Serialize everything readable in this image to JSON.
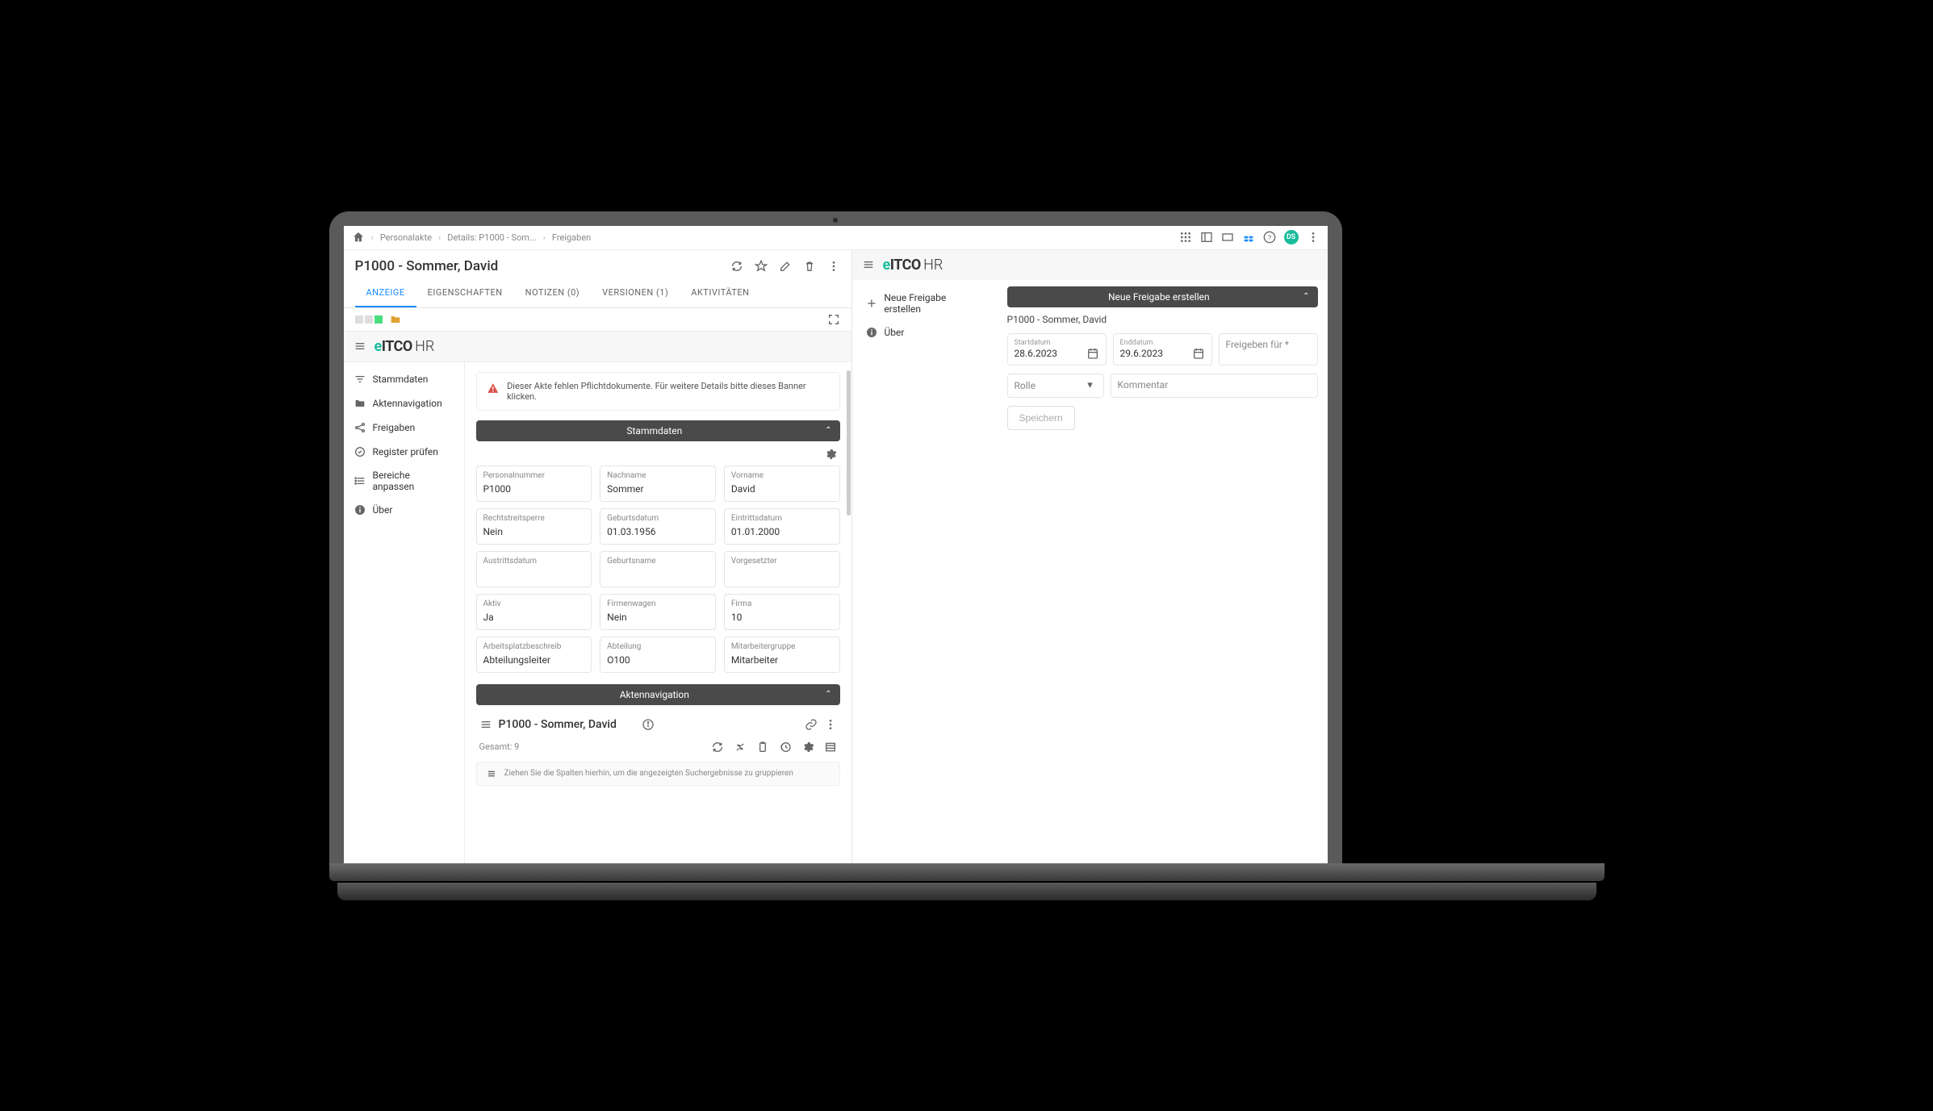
{
  "breadcrumbs": {
    "c1": "Personalakte",
    "c2": "Details: P1000 - Som...",
    "c3": "Freigaben"
  },
  "topRight": {
    "avatar": "DS"
  },
  "doc": {
    "title": "P1000 - Sommer, David"
  },
  "tabs": {
    "anzeige": "ANZEIGE",
    "eigenschaften": "EIGENSCHAFTEN",
    "notizen": "NOTIZEN (0)",
    "versionen": "VERSIONEN (1)",
    "aktivitaeten": "AKTIVITÄTEN"
  },
  "logo": {
    "e": "e",
    "itco": "ITCO",
    "hr": "HR"
  },
  "sideNav": {
    "stammdaten": "Stammdaten",
    "aktennav": "Aktennavigation",
    "freigaben": "Freigaben",
    "register": "Register prüfen",
    "bereiche": "Bereiche anpassen",
    "ueber": "Über"
  },
  "banner": {
    "text": "Dieser Akte fehlen Pflichtdokumente. Für weitere Details bitte dieses Banner klicken."
  },
  "sect": {
    "stammdaten": "Stammdaten",
    "aktennav": "Aktennavigation"
  },
  "fields": {
    "personalnummer": {
      "l": "Personalnummer",
      "v": "P1000"
    },
    "nachname": {
      "l": "Nachname",
      "v": "Sommer"
    },
    "vorname": {
      "l": "Vorname",
      "v": "David"
    },
    "rechtstreitsperre": {
      "l": "Rechtstreitsperre",
      "v": "Nein"
    },
    "geburtsdatum": {
      "l": "Geburtsdatum",
      "v": "01.03.1956"
    },
    "eintrittsdatum": {
      "l": "Eintrittsdatum",
      "v": "01.01.2000"
    },
    "austrittsdatum": {
      "l": "Austrittsdatum",
      "v": ""
    },
    "geburtsname": {
      "l": "Geburtsname",
      "v": ""
    },
    "vorgesetzter": {
      "l": "Vorgesetzter",
      "v": ""
    },
    "aktiv": {
      "l": "Aktiv",
      "v": "Ja"
    },
    "firmenwagen": {
      "l": "Firmenwagen",
      "v": "Nein"
    },
    "firma": {
      "l": "Firma",
      "v": "10"
    },
    "arbeitsplatz": {
      "l": "Arbeitsplatzbeschreib",
      "v": "Abteilungsleiter"
    },
    "abteilung": {
      "l": "Abteilung",
      "v": "O100"
    },
    "mitarbeitergruppe": {
      "l": "Mitarbeitergruppe",
      "v": "Mitarbeiter"
    }
  },
  "akten": {
    "title": "P1000 - Sommer, David",
    "count": "Gesamt: 9",
    "drag": "Ziehen Sie die Spalten hierhin, um die angezeigten Suchergebnisse zu gruppieren"
  },
  "rightNav": {
    "neue": "Neue Freigabe erstellen",
    "ueber": "Über"
  },
  "freigabe": {
    "title": "Neue Freigabe erstellen",
    "sub": "P1000 - Sommer, David",
    "startdatum": {
      "l": "Startdatum",
      "v": "28.6.2023"
    },
    "enddatum": {
      "l": "Enddatum",
      "v": "29.6.2023"
    },
    "freigebenFuer": "Freigeben für *",
    "rolle": "Rolle",
    "kommentar": "Kommentar",
    "speichern": "Speichern"
  }
}
